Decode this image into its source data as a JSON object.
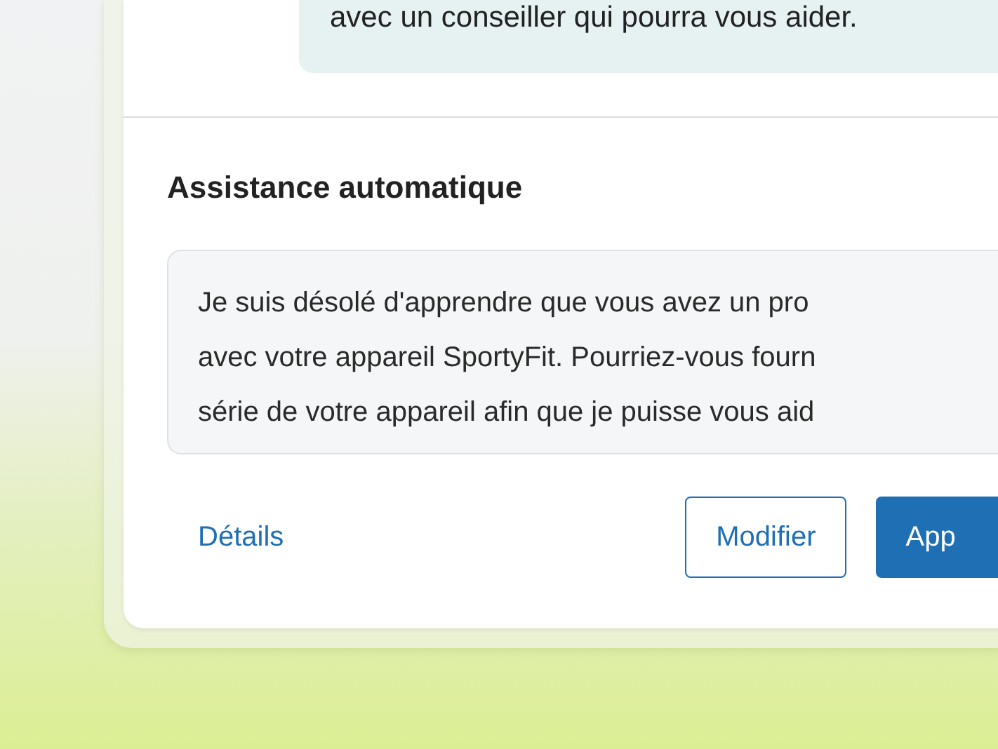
{
  "chat_bubble": {
    "text": "avec un conseiller qui pourra vous aider."
  },
  "section": {
    "title": "Assistance automatique"
  },
  "reply_box": {
    "lines": [
      "Je suis désolé d'apprendre que vous avez un pro",
      "avec votre appareil SportyFit. Pourriez-vous fourn",
      "série de votre appareil afin que je puisse vous aid"
    ]
  },
  "actions": [
    {
      "kind": "link",
      "label": "Détails"
    },
    {
      "kind": "outline",
      "label": "Modifier"
    },
    {
      "kind": "primary",
      "label": "App"
    }
  ]
}
